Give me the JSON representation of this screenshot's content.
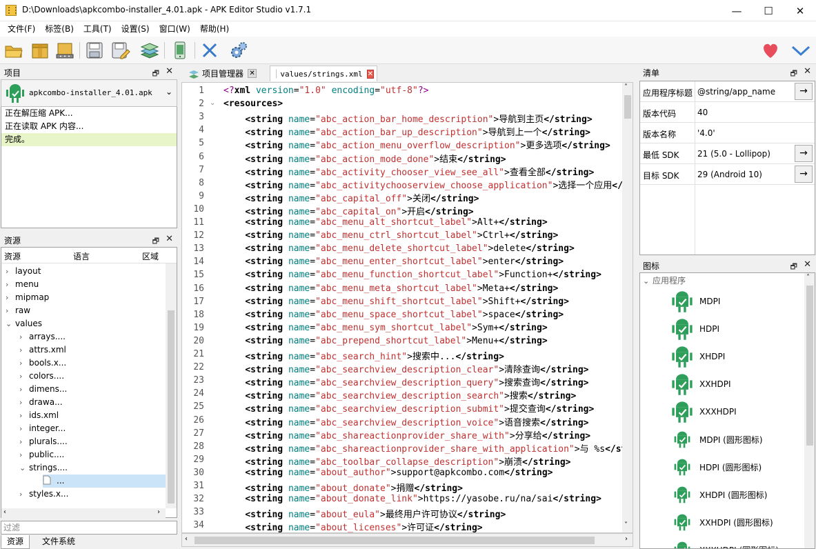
{
  "window": {
    "title": "D:\\Downloads\\apkcombo-installer_4.01.apk - APK Editor Studio v1.7.1",
    "min_glyph": "—",
    "max_glyph": "☐",
    "close_glyph": "✕"
  },
  "menu": [
    "文件(F)",
    "标签(B)",
    "工具(T)",
    "设置(S)",
    "窗口(W)",
    "帮助(H)"
  ],
  "toolbar": {
    "icons": [
      "folder-open-icon",
      "package-icon",
      "package-install-icon",
      "save-icon",
      "save-as-icon",
      "layers-icon",
      "device-icon",
      "close-icon",
      "settings-icon"
    ],
    "right_icons": [
      "heart-icon",
      "update-icon"
    ]
  },
  "project_panel": {
    "title": "项目",
    "selected_apk": "apkcombo-installer_4.01.apk",
    "log": [
      "正在解压缩 APK...",
      "正在读取 APK 内容...",
      "完成。"
    ]
  },
  "resources_panel": {
    "title": "资源",
    "columns": [
      "资源",
      "语言",
      "区域"
    ],
    "items": [
      {
        "label": "layout",
        "level": 0,
        "expanded": false
      },
      {
        "label": "menu",
        "level": 0,
        "expanded": false
      },
      {
        "label": "mipmap",
        "level": 0,
        "expanded": false
      },
      {
        "label": "raw",
        "level": 0,
        "expanded": false
      },
      {
        "label": "values",
        "level": 0,
        "expanded": true
      },
      {
        "label": "arrays....",
        "level": 1,
        "expanded": false
      },
      {
        "label": "attrs.xml",
        "level": 1,
        "expanded": false
      },
      {
        "label": "bools.x...",
        "level": 1,
        "expanded": false
      },
      {
        "label": "colors....",
        "level": 1,
        "expanded": false
      },
      {
        "label": "dimens...",
        "level": 1,
        "expanded": false
      },
      {
        "label": "drawa...",
        "level": 1,
        "expanded": false
      },
      {
        "label": "ids.xml",
        "level": 1,
        "expanded": false
      },
      {
        "label": "integer...",
        "level": 1,
        "expanded": false
      },
      {
        "label": "plurals....",
        "level": 1,
        "expanded": false
      },
      {
        "label": "public....",
        "level": 1,
        "expanded": false
      },
      {
        "label": "strings....",
        "level": 1,
        "expanded": true
      },
      {
        "label": "...",
        "level": 2,
        "expanded": false
      },
      {
        "label": "styles.x...",
        "level": 1,
        "expanded": false
      }
    ],
    "filter_placeholder": "过滤",
    "bottom_tabs": [
      "资源",
      "文件系统"
    ]
  },
  "editor": {
    "tabs": [
      "项目管理器",
      "values/strings.xml"
    ],
    "lines": [
      {
        "n": "1",
        "t": "decl",
        "text": "<?xml version=\"1.0\" encoding=\"utf-8\"?>"
      },
      {
        "n": "2",
        "t": "open",
        "text": "<resources>"
      },
      {
        "n": "3",
        "name": "abc_action_bar_home_description",
        "value": "导航到主页"
      },
      {
        "n": "4",
        "name": "abc_action_bar_up_description",
        "value": "导航到上一个"
      },
      {
        "n": "5",
        "name": "abc_action_menu_overflow_description",
        "value": "更多选项"
      },
      {
        "n": "6",
        "name": "abc_action_mode_done",
        "value": "结束"
      },
      {
        "n": "7",
        "name": "abc_activity_chooser_view_see_all",
        "value": "查看全部"
      },
      {
        "n": "8",
        "name": "abc_activitychooserview_choose_application",
        "value": "选择一个应用"
      },
      {
        "n": "9",
        "name": "abc_capital_off",
        "value": "关闭"
      },
      {
        "n": "10",
        "name": "abc_capital_on",
        "value": "开启"
      },
      {
        "n": "11",
        "name": "abc_menu_alt_shortcut_label",
        "value": "Alt+"
      },
      {
        "n": "12",
        "name": "abc_menu_ctrl_shortcut_label",
        "value": "Ctrl+"
      },
      {
        "n": "13",
        "name": "abc_menu_delete_shortcut_label",
        "value": "delete"
      },
      {
        "n": "14",
        "name": "abc_menu_enter_shortcut_label",
        "value": "enter"
      },
      {
        "n": "15",
        "name": "abc_menu_function_shortcut_label",
        "value": "Function+"
      },
      {
        "n": "16",
        "name": "abc_menu_meta_shortcut_label",
        "value": "Meta+"
      },
      {
        "n": "17",
        "name": "abc_menu_shift_shortcut_label",
        "value": "Shift+"
      },
      {
        "n": "18",
        "name": "abc_menu_space_shortcut_label",
        "value": "space"
      },
      {
        "n": "19",
        "name": "abc_menu_sym_shortcut_label",
        "value": "Sym+"
      },
      {
        "n": "20",
        "name": "abc_prepend_shortcut_label",
        "value": "Menu+"
      },
      {
        "n": "21",
        "name": "abc_search_hint",
        "value": "搜索中..."
      },
      {
        "n": "22",
        "name": "abc_searchview_description_clear",
        "value": "清除查询"
      },
      {
        "n": "23",
        "name": "abc_searchview_description_query",
        "value": "搜索查询"
      },
      {
        "n": "24",
        "name": "abc_searchview_description_search",
        "value": "搜索"
      },
      {
        "n": "25",
        "name": "abc_searchview_description_submit",
        "value": "提交查询"
      },
      {
        "n": "26",
        "name": "abc_searchview_description_voice",
        "value": "语音搜索"
      },
      {
        "n": "27",
        "name": "abc_shareactionprovider_share_with",
        "value": "分享给"
      },
      {
        "n": "28",
        "name": "abc_shareactionprovider_share_with_application",
        "value": "与 %s"
      },
      {
        "n": "29",
        "name": "abc_toolbar_collapse_description",
        "value": "崩溃"
      },
      {
        "n": "30",
        "name": "about_author",
        "value": "support@apkcombo.com"
      },
      {
        "n": "31",
        "name": "about_donate",
        "value": "捐赠"
      },
      {
        "n": "32",
        "name": "about_donate_link",
        "value": "https://yasobe.ru/na/sai"
      },
      {
        "n": "33",
        "name": "about_eula",
        "value": "最终用户许可协议"
      },
      {
        "n": "34",
        "name": "about_licenses",
        "value": "许可证"
      }
    ]
  },
  "manifest_panel": {
    "title": "清单",
    "rows": [
      {
        "key": "应用程序标题",
        "value": "@string/app_name",
        "button": "→"
      },
      {
        "key": "版本代码",
        "value": "40",
        "button": ""
      },
      {
        "key": "版本名称",
        "value": "'4.0'",
        "button": ""
      },
      {
        "key": "最低 SDK",
        "value": "21 (5.0 - Lollipop)",
        "button": "→"
      },
      {
        "key": "目标 SDK",
        "value": "29 (Android 10)",
        "button": "→"
      }
    ]
  },
  "icons_panel": {
    "title": "图标",
    "group": "应用程序",
    "items": [
      "MDPI",
      "HDPI",
      "XHDPI",
      "XXHDPI",
      "XXXHDPI",
      "MDPI (圆形图标)",
      "HDPI (圆形图标)",
      "XHDPI (圆形图标)",
      "XXHDPI (圆形图标)",
      "XXXHDPI (圆形图标)"
    ]
  },
  "colors": {
    "android_green": "#2e9e5b",
    "highlight": "#e8f5c8",
    "heart": "#e84d5b",
    "check_blue": "#3a7fcf"
  }
}
